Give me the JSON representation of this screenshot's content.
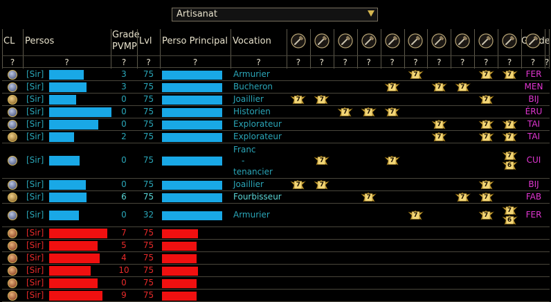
{
  "filter": {
    "label": "Artisanat"
  },
  "header": {
    "cl": "CL",
    "persos": "Persos",
    "grade_line1": "Grade",
    "grade_line2": "PVMP",
    "lvl": "Lvl",
    "perso_principal": "Perso Principal",
    "vocation": "Vocation",
    "guilde": "Guilde",
    "question": "?"
  },
  "craft_icons": [
    "compass-icon",
    "saw-icon",
    "hammer-icon",
    "hammer-icon",
    "axe-icon",
    "chisel-icon",
    "pickaxe-icon",
    "knife-icon",
    "mallet-icon",
    "hammer-icon",
    "mace-icon"
  ],
  "colors": {
    "ally_bar": "#19a8e6",
    "enemy_bar": "#f01010",
    "vocation": "#2aa6b8",
    "guild": "#e236d2",
    "badge": "#d9b340"
  },
  "rows": [
    {
      "faction": "ally",
      "tag": "[Sir]",
      "bar": 0.72,
      "grade": "3",
      "lvl": "75",
      "main_bar": 1.0,
      "vocation": [
        "Armurier"
      ],
      "guild": "FER",
      "badges": [
        [
          5,
          "7"
        ],
        [
          8,
          "7"
        ],
        [
          9,
          "7"
        ]
      ]
    },
    {
      "faction": "ally",
      "tag": "[Sir]",
      "bar": 0.77,
      "grade": "3",
      "lvl": "75",
      "main_bar": 1.0,
      "vocation": [
        "Bucheron"
      ],
      "guild": "MEN",
      "badges": [
        [
          4,
          "7"
        ],
        [
          6,
          "7"
        ],
        [
          7,
          "7"
        ]
      ]
    },
    {
      "faction": "ally",
      "tag": "[Sir]",
      "bar": 0.55,
      "grade": "0",
      "lvl": "75",
      "main_bar": 1.0,
      "vocation": [
        "Joaillier"
      ],
      "guild": "BIJ",
      "badges": [
        [
          0,
          "7"
        ],
        [
          1,
          "7"
        ],
        [
          8,
          "7"
        ]
      ]
    },
    {
      "faction": "ally",
      "tag": "[Sir]",
      "bar": 1.28,
      "grade": "0",
      "lvl": "75",
      "main_bar": 1.0,
      "vocation": [
        "Historien"
      ],
      "guild": "ÉRU",
      "badges": [
        [
          2,
          "7"
        ],
        [
          3,
          "7"
        ],
        [
          4,
          "7"
        ]
      ]
    },
    {
      "faction": "ally",
      "tag": "[Sir]",
      "bar": 1.02,
      "grade": "0",
      "lvl": "75",
      "main_bar": 1.0,
      "vocation": [
        "Explorateur"
      ],
      "guild": "TAI",
      "badges": [
        [
          6,
          "7"
        ],
        [
          8,
          "7"
        ],
        [
          9,
          "7"
        ]
      ]
    },
    {
      "faction": "ally",
      "tag": "[Sir]",
      "bar": 0.52,
      "grade": "2",
      "lvl": "75",
      "main_bar": 1.0,
      "vocation": [
        "Explorateur"
      ],
      "guild": "TAI",
      "badges": [
        [
          6,
          "7"
        ],
        [
          8,
          "7"
        ],
        [
          9,
          "7"
        ]
      ]
    },
    {
      "faction": "ally",
      "tag": "[Sir]",
      "bar": 0.63,
      "grade": "0",
      "lvl": "75",
      "main_bar": 1.0,
      "vocation": [
        "Franc",
        "-",
        "tenancier"
      ],
      "guild": "CUI",
      "tall": true,
      "badges": [
        [
          1,
          "7"
        ],
        [
          4,
          "7"
        ],
        [
          9,
          "7"
        ],
        [
          9,
          "6"
        ]
      ]
    },
    {
      "faction": "ally",
      "tag": "[Sir]",
      "bar": 0.75,
      "grade": "0",
      "lvl": "75",
      "main_bar": 1.0,
      "vocation": [
        "Joaillier"
      ],
      "guild": "BIJ",
      "badges": [
        [
          0,
          "7"
        ],
        [
          1,
          "7"
        ],
        [
          8,
          "7"
        ]
      ]
    },
    {
      "faction": "ally",
      "tag": "[Sir]",
      "bar": 0.77,
      "grade": "6",
      "lvl": "75",
      "main_bar": 1.0,
      "vocation": [
        "Fourbisseur"
      ],
      "guild": "FAB",
      "highlight": true,
      "badges": [
        [
          3,
          "7"
        ],
        [
          7,
          "7"
        ],
        [
          8,
          "7"
        ]
      ]
    },
    {
      "faction": "ally",
      "tag": "[Sir]",
      "bar": 0.62,
      "grade": "0",
      "lvl": "32",
      "main_bar": 1.0,
      "vocation": [
        "Armurier"
      ],
      "guild": "FER",
      "medium": true,
      "badges": [
        [
          5,
          "7"
        ],
        [
          8,
          "7"
        ],
        [
          9,
          "7"
        ],
        [
          9,
          "6"
        ]
      ]
    },
    {
      "faction": "enemy",
      "tag": "[Sir]",
      "bar": 1.2,
      "grade": "7",
      "lvl": "75",
      "main_bar": 0.6,
      "vocation": [],
      "guild": "",
      "badges": []
    },
    {
      "faction": "enemy",
      "tag": "[Sir]",
      "bar": 1.0,
      "grade": "5",
      "lvl": "75",
      "main_bar": 0.57,
      "vocation": [],
      "guild": "",
      "badges": []
    },
    {
      "faction": "enemy",
      "tag": "[Sir]",
      "bar": 1.04,
      "grade": "4",
      "lvl": "75",
      "main_bar": 0.57,
      "vocation": [],
      "guild": "",
      "badges": []
    },
    {
      "faction": "enemy",
      "tag": "[Sir]",
      "bar": 0.85,
      "grade": "10",
      "lvl": "75",
      "main_bar": 0.6,
      "vocation": [],
      "guild": "",
      "badges": []
    },
    {
      "faction": "enemy",
      "tag": "[Sir]",
      "bar": 1.0,
      "grade": "0",
      "lvl": "75",
      "main_bar": 0.57,
      "vocation": [],
      "guild": "",
      "badges": []
    },
    {
      "faction": "enemy",
      "tag": "[Sir]",
      "bar": 1.1,
      "grade": "9",
      "lvl": "75",
      "main_bar": 0.57,
      "vocation": [],
      "guild": "",
      "badges": []
    }
  ]
}
